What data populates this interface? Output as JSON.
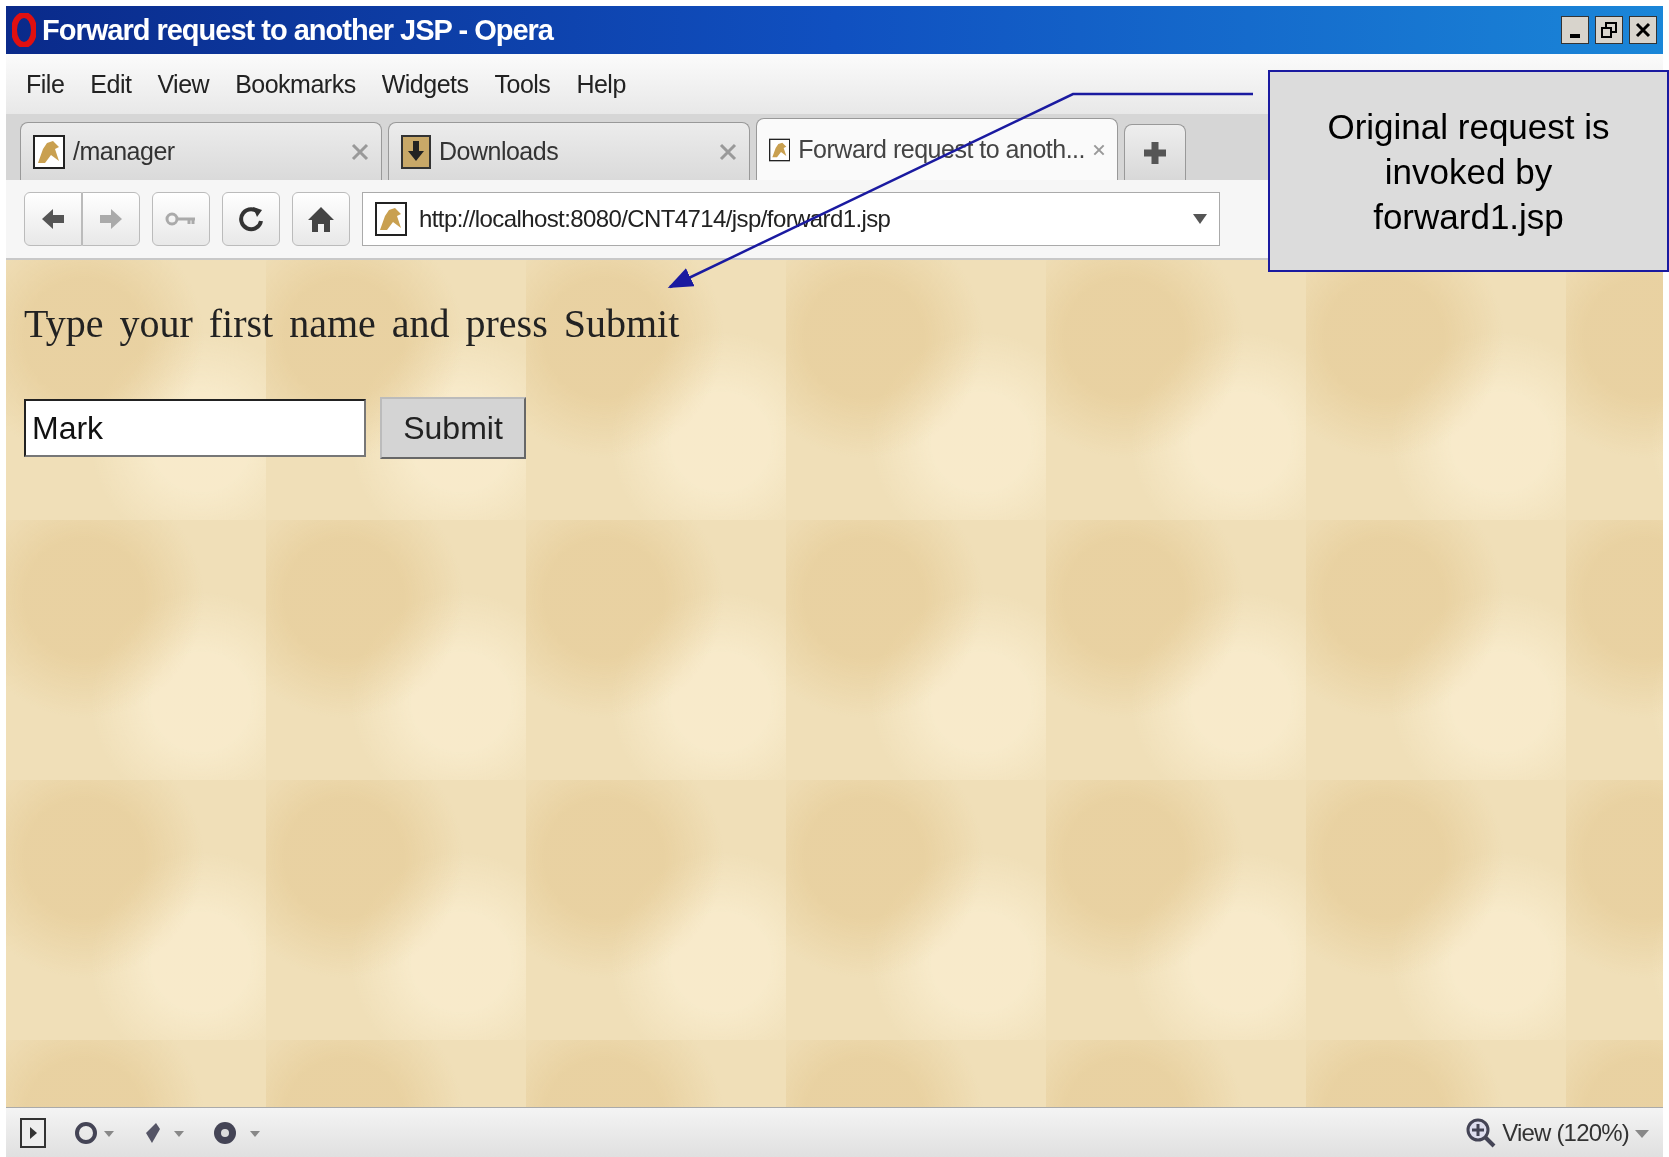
{
  "window": {
    "title": "Forward request to another JSP - Opera"
  },
  "menu": [
    "File",
    "Edit",
    "View",
    "Bookmarks",
    "Widgets",
    "Tools",
    "Help"
  ],
  "tabs": [
    {
      "label": "/manager",
      "kind": "page",
      "selected": false
    },
    {
      "label": "Downloads",
      "kind": "downloads",
      "selected": false
    },
    {
      "label": "Forward request to anoth...",
      "kind": "page",
      "selected": true
    }
  ],
  "address": {
    "value": "http://localhost:8080/CNT4714/jsp/forward1.jsp"
  },
  "page": {
    "prompt": "Type your first name and press Submit",
    "name_field": {
      "value": "Mark"
    },
    "submit": "Submit"
  },
  "status_bar": {
    "zoom": "View (120%)"
  },
  "callout": {
    "text": "Original request is invoked by forward1.jsp"
  }
}
